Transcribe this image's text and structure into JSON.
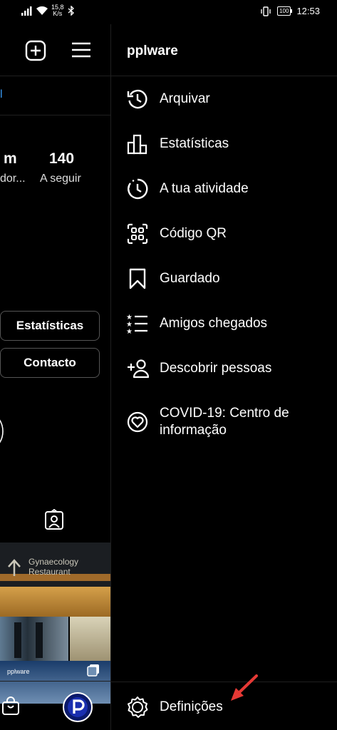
{
  "status_bar": {
    "net_speed_value": "15,8",
    "net_speed_unit": "K/s",
    "battery": "100",
    "time": "12:53"
  },
  "profile": {
    "partial_link": "l",
    "followers_partial_value": "m",
    "followers_partial_label": "dor...",
    "following_value": "140",
    "following_label": "A seguir",
    "insights_button": "Estatísticas",
    "contact_button": "Contacto",
    "photo_sign_line1": "Gynaecology",
    "photo_sign_line2": "Restaurant",
    "photo_brand": "pplware"
  },
  "drawer": {
    "title": "pplware",
    "items": [
      {
        "label": "Arquivar",
        "icon": "archive-icon"
      },
      {
        "label": "Estatísticas",
        "icon": "insights-icon"
      },
      {
        "label": "A tua atividade",
        "icon": "activity-icon"
      },
      {
        "label": "Código QR",
        "icon": "qr-code-icon"
      },
      {
        "label": "Guardado",
        "icon": "bookmark-icon"
      },
      {
        "label": "Amigos chegados",
        "icon": "close-friends-icon"
      },
      {
        "label": "Descobrir pessoas",
        "icon": "add-person-icon"
      },
      {
        "label": "COVID-19: Centro de informação",
        "icon": "covid-info-icon"
      }
    ],
    "settings_label": "Definições"
  },
  "colors": {
    "accent_link": "#3797f0",
    "annotation_arrow": "#e53935"
  }
}
